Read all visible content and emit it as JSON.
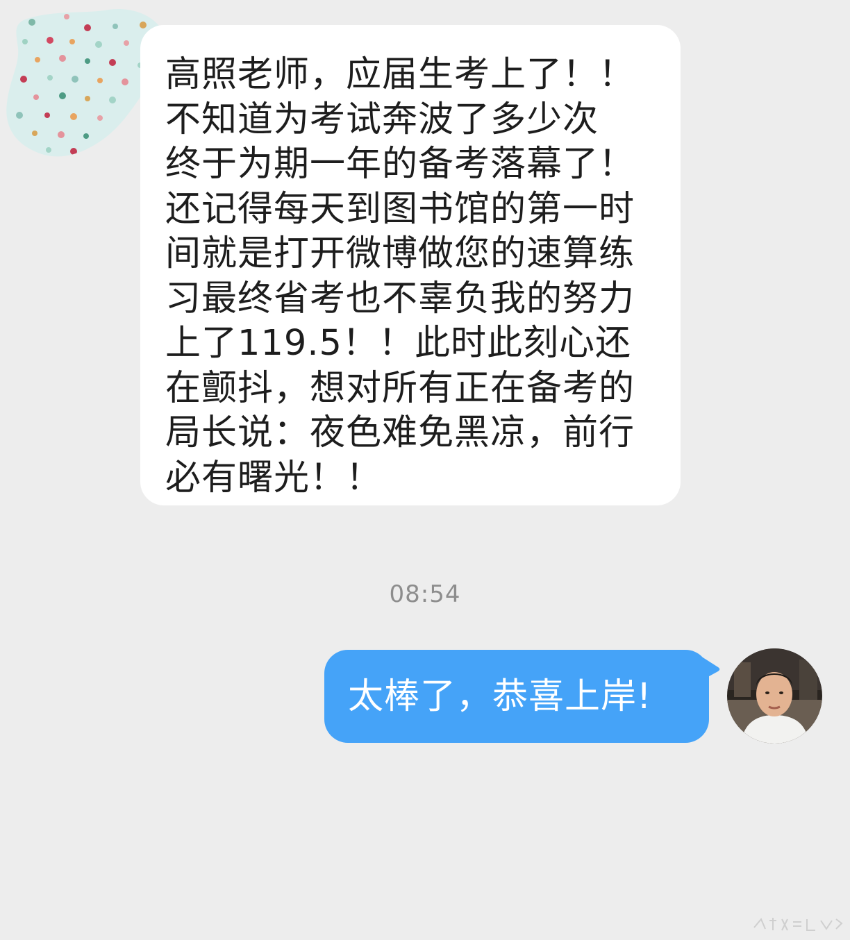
{
  "conversation": {
    "incoming": {
      "text": "高照老师，应届生考上了！！\n不知道为考试奔波了多少次\n终于为期一年的备考落幕了！\n还记得每天到图书馆的第一时\n间就是打开微博做您的速算练\n习最终省考也不辜负我的努力\n上了119.5！！此时此刻心还\n在颤抖，想对所有正在备考的\n局长说：夜色难免黑凉，前行\n必有曙光！！"
    },
    "timestamp": "08:54",
    "outgoing": {
      "text": "太棒了，恭喜上岸!"
    }
  },
  "colors": {
    "background": "#ededed",
    "incoming_bubble": "#ffffff",
    "outgoing_bubble": "#45a3f8",
    "text_dark": "#1d1d1d",
    "timestamp": "#8d8d8d"
  },
  "icons": {
    "incoming_avatar": "polka-dot-avatar-icon",
    "outgoing_avatar": "user-photo-avatar"
  }
}
